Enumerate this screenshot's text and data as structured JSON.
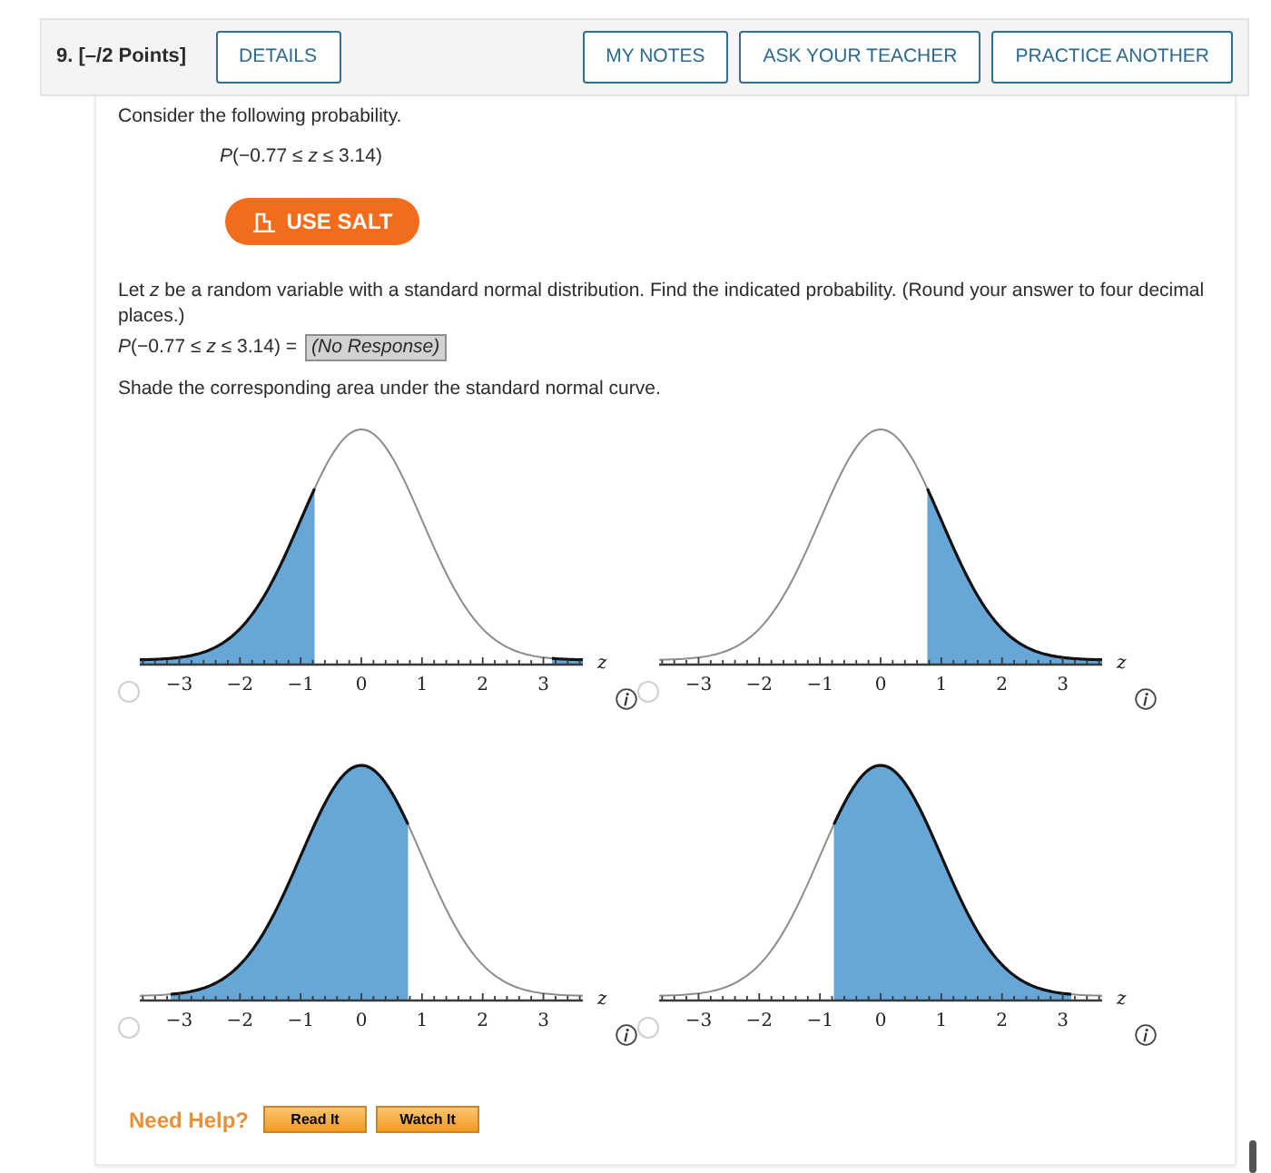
{
  "header": {
    "title": "9. [–/2 Points]",
    "details_button": {
      "label": "DETAILS"
    },
    "action_buttons": [
      {
        "label": "MY NOTES"
      },
      {
        "label": "ASK YOUR TEACHER"
      },
      {
        "label": "PRACTICE ANOTHER"
      }
    ]
  },
  "intro": "Consider the following probability.",
  "expression": "*P*(−0.77 ≤ *z* ≤ 3.14)",
  "salt_button": {
    "label": "USE SALT"
  },
  "instructions": "Let *z* be a random variable with a standard normal distribution. Find the indicated probability. (Round your answer to four decimal places.)",
  "answer": {
    "label": "*P*(−0.77 ≤ *z* ≤ 3.14) =",
    "value": "(No Response)"
  },
  "shade_prompt": "Shade the corresponding area under the standard normal curve.",
  "options": [
    {
      "selected": false,
      "kind": "two_tails",
      "axis_label": "z",
      "tick_labels": [
        "−3",
        "−2",
        "−1",
        "0",
        "1",
        "2",
        "3"
      ]
    },
    {
      "selected": false,
      "kind": "right_tail",
      "axis_label": "z",
      "tick_labels": [
        "−3",
        "−2",
        "−1",
        "0",
        "1",
        "2",
        "3"
      ]
    },
    {
      "selected": false,
      "kind": "left_body",
      "axis_label": "z",
      "tick_labels": [
        "−3",
        "−2",
        "−1",
        "0",
        "1",
        "2",
        "3"
      ]
    },
    {
      "selected": false,
      "kind": "right_body",
      "axis_label": "z",
      "tick_labels": [
        "−3",
        "−2",
        "−1",
        "0",
        "1",
        "2",
        "3"
      ]
    }
  ],
  "help": {
    "label": "Need Help?",
    "buttons": [
      {
        "label": "Read It"
      },
      {
        "label": "Watch It"
      }
    ]
  }
}
